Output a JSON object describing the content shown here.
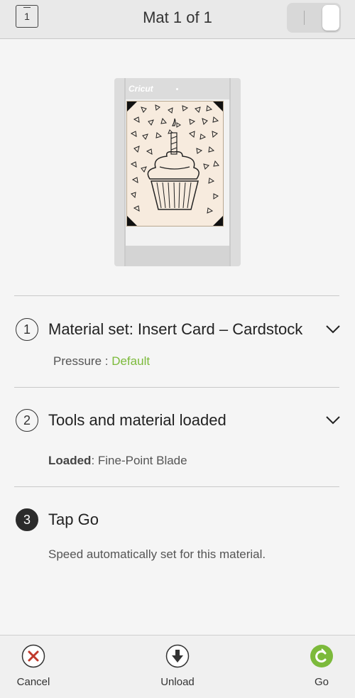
{
  "header": {
    "mat_number": "1",
    "title": "Mat 1 of 1"
  },
  "mat_preview": {
    "brand": "Cricut"
  },
  "steps": [
    {
      "number": "1",
      "title": "Material set: Insert Card –  Cardstock",
      "detail_label": "Pressure : ",
      "detail_value": "Default"
    },
    {
      "number": "2",
      "title": "Tools and material loaded",
      "detail_label": "Loaded",
      "detail_value": ": Fine-Point Blade"
    },
    {
      "number": "3",
      "title": "Tap Go",
      "detail": "Speed automatically set for this material."
    }
  ],
  "toolbar": {
    "cancel_label": "Cancel",
    "unload_label": "Unload",
    "go_label": "Go"
  },
  "colors": {
    "accent_green": "#7cba3b",
    "cancel_red": "#c0392b"
  }
}
